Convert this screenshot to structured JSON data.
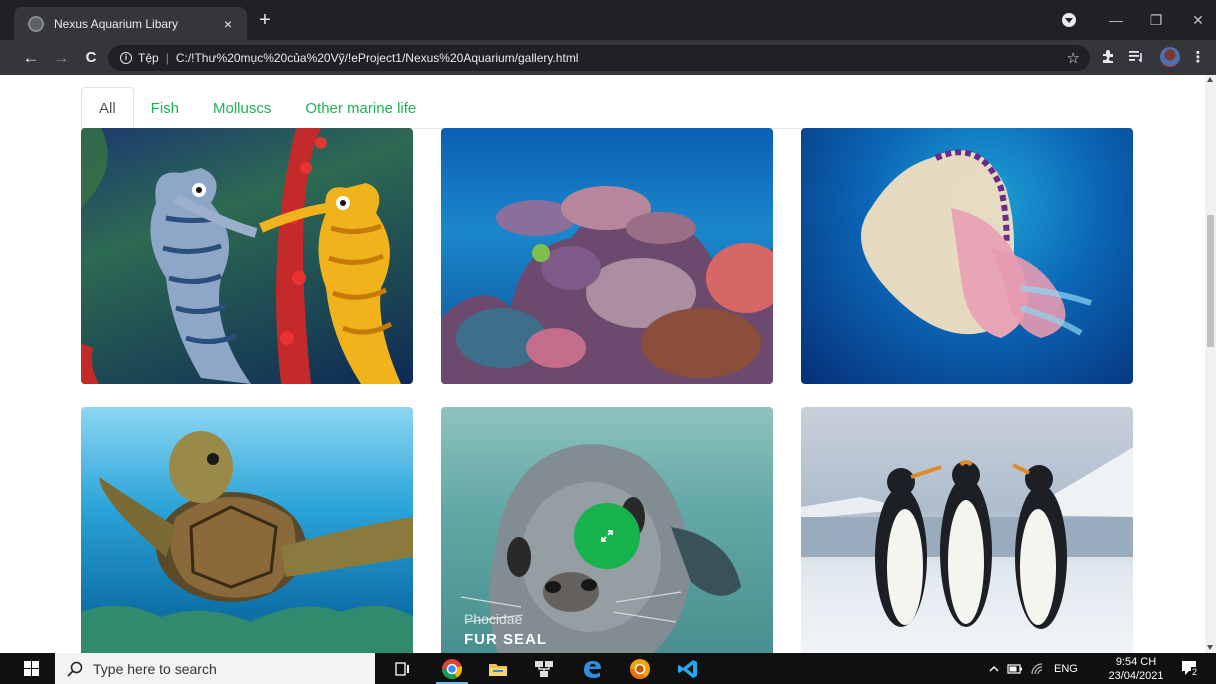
{
  "browser": {
    "tab_title": "Nexus Aquarium Libary",
    "tab_close": "×",
    "new_tab": "+",
    "scheme_label": "Tệp",
    "url": "C:/!Thư%20mục%20của%20Vỹ/!eProject1/Nexus%20Aquarium/gallery.html",
    "back": "←",
    "forward": "→",
    "reload": "C",
    "window_min": "—",
    "window_max": "❐",
    "window_close": "✕",
    "star": "☆",
    "menu": "⋮"
  },
  "gallery": {
    "filters": [
      {
        "label": "All",
        "active": true
      },
      {
        "label": "Fish",
        "active": false
      },
      {
        "label": "Molluscs",
        "active": false
      },
      {
        "label": "Other marine life",
        "active": false
      }
    ],
    "hovered_caption": {
      "subtitle": "Phocidae",
      "title": "FUR SEAL"
    },
    "accent": "#16b24c"
  },
  "taskbar": {
    "search_placeholder": "Type here to search",
    "language": "ENG",
    "time": "9:54 CH",
    "date": "23/04/2021",
    "notification_count": "2"
  }
}
